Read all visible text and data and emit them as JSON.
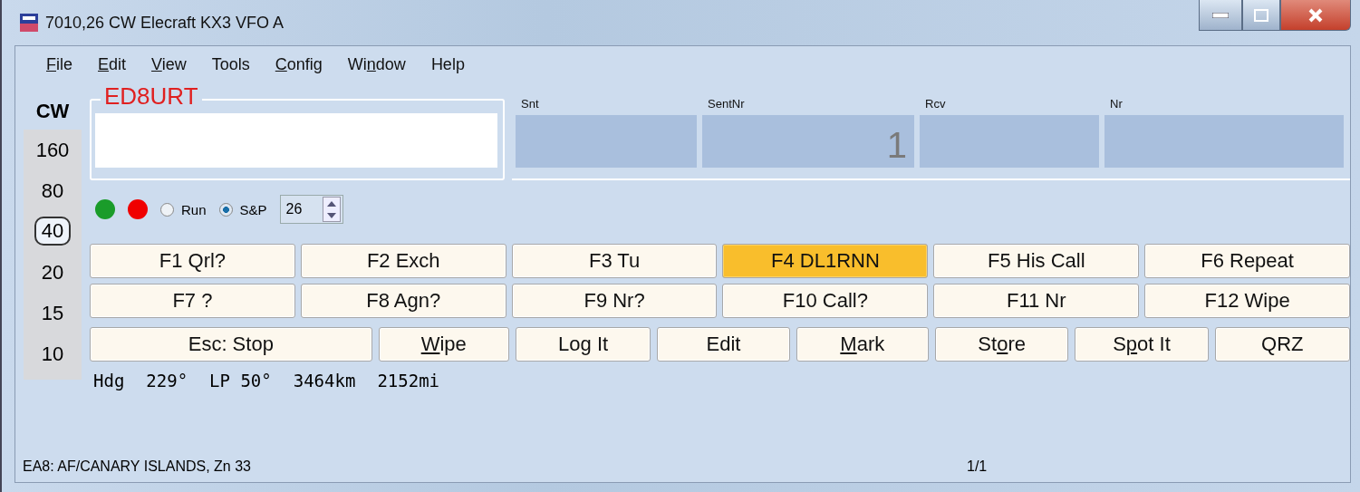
{
  "window": {
    "title": "7010,26 CW Elecraft KX3 VFO A"
  },
  "menu": [
    {
      "key": "F",
      "post": "ile"
    },
    {
      "key": "E",
      "post": "dit"
    },
    {
      "key": "V",
      "post": "iew"
    },
    {
      "pre": "Tools"
    },
    {
      "key": "C",
      "post": "onfig"
    },
    {
      "pre": "Wi",
      "key": "n",
      "post": "dow"
    },
    {
      "pre": "Help"
    }
  ],
  "mode": "CW",
  "bands": [
    {
      "label": "160",
      "selected": false
    },
    {
      "label": "80",
      "selected": false
    },
    {
      "label": "40",
      "selected": true
    },
    {
      "label": "20",
      "selected": false
    },
    {
      "label": "15",
      "selected": false
    },
    {
      "label": "10",
      "selected": false
    }
  ],
  "call": {
    "label": "ED8URT"
  },
  "exchange": [
    {
      "label": "Snt"
    },
    {
      "label": "SentNr",
      "value": "1"
    },
    {
      "label": "Rcv"
    },
    {
      "label": "Nr"
    }
  ],
  "indicators": [
    {
      "color": "#1a9c2a"
    },
    {
      "color": "#f00000"
    }
  ],
  "radios": [
    {
      "label": "Run",
      "selected": false
    },
    {
      "label": "S&P",
      "selected": true
    }
  ],
  "spinner": {
    "value": "26"
  },
  "function_keys": [
    {
      "label": "F1 Qrl?",
      "selected": false
    },
    {
      "label": "F2 Exch",
      "selected": false
    },
    {
      "label": "F3 Tu",
      "selected": false
    },
    {
      "label": "F4 DL1RNN",
      "selected": true
    },
    {
      "label": "F5 His Call",
      "selected": false
    },
    {
      "label": "F6 Repeat",
      "selected": false
    },
    {
      "label": "F7 ?",
      "selected": false
    },
    {
      "label": "F8 Agn?",
      "selected": false
    },
    {
      "label": "F9 Nr?",
      "selected": false
    },
    {
      "label": "F10 Call?",
      "selected": false
    },
    {
      "label": "F11 Nr",
      "selected": false
    },
    {
      "label": "F12 Wipe",
      "selected": false
    }
  ],
  "actions": [
    {
      "pre": "Esc: Stop"
    },
    {
      "key": "W",
      "post": "ipe"
    },
    {
      "pre": "Log It"
    },
    {
      "pre": "Edit"
    },
    {
      "key": "M",
      "post": "ark"
    },
    {
      "pre": "St",
      "key": "o",
      "post": "re"
    },
    {
      "pre": "S",
      "key": "p",
      "post": "ot It"
    },
    {
      "pre": "QRZ"
    }
  ],
  "info": [
    "Hdg",
    "229°",
    "LP 50°",
    "3464km",
    "2152mi"
  ],
  "status_bar": {
    "left": "EA8: AF/CANARY ISLANDS, Zn 33",
    "center": "1/1"
  }
}
